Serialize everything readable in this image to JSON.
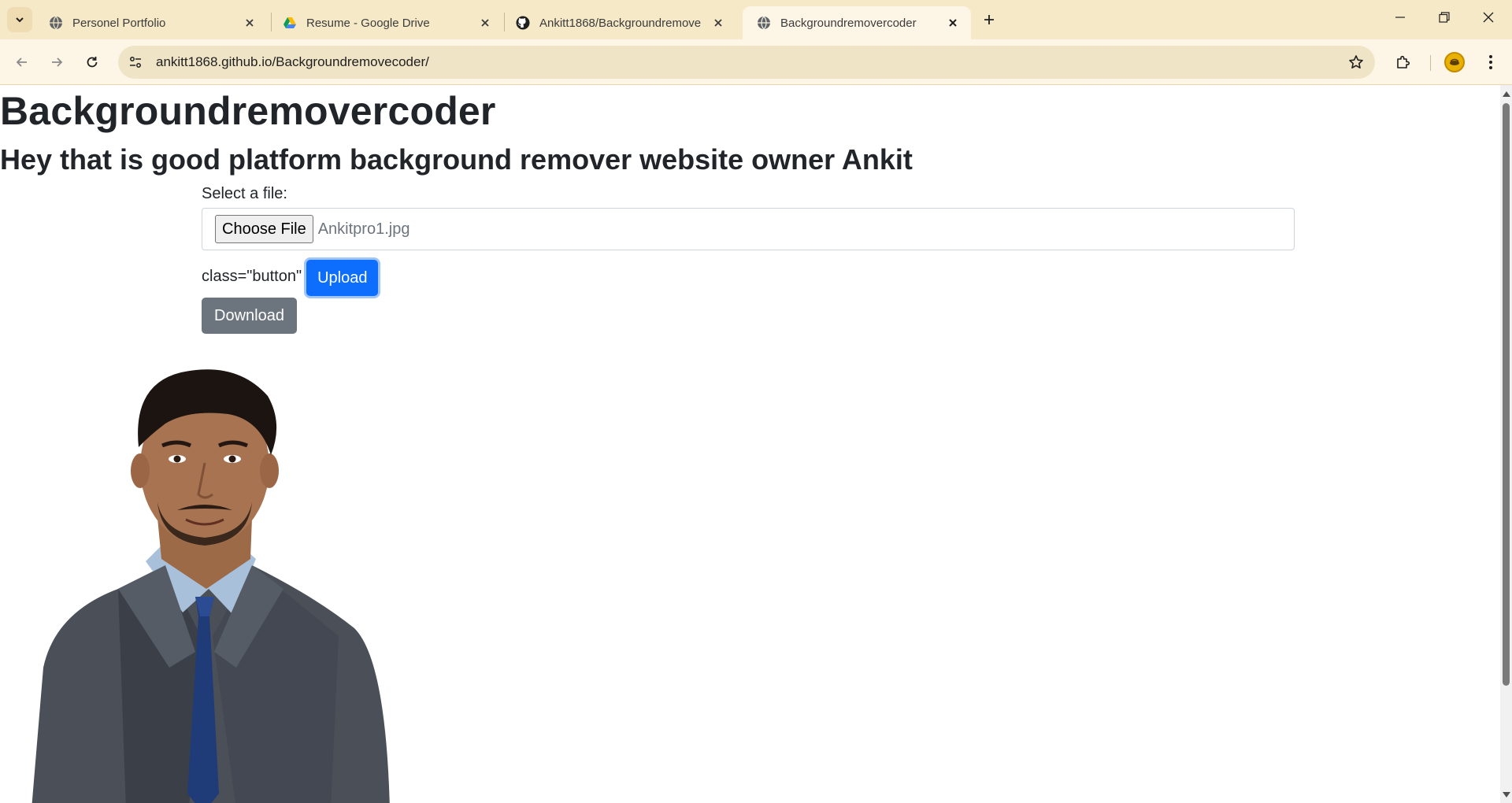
{
  "browser": {
    "tabs": [
      {
        "title": "Personel Portfolio",
        "favicon": "globe-icon",
        "active": false
      },
      {
        "title": "Resume - Google Drive",
        "favicon": "google-drive-icon",
        "active": false
      },
      {
        "title": "Ankitt1868/Backgroundremove",
        "favicon": "github-icon",
        "active": false
      },
      {
        "title": "Backgroundremovercoder",
        "favicon": "globe-icon",
        "active": true
      }
    ],
    "url": "ankitt1868.github.io/Backgroundremovecoder/",
    "theme_color": "#f6e9c8"
  },
  "page": {
    "title": "Backgroundremovercoder",
    "subtitle": "Hey that is good platform background remover website owner Ankit",
    "file_label": "Select a file:",
    "choose_file_label": "Choose File",
    "file_name": "Ankitpro1.jpg",
    "class_text": "class=\"button\"",
    "upload_label": "Upload",
    "download_label": "Download",
    "colors": {
      "upload": "#0d6efd",
      "download": "#6c757d"
    }
  }
}
